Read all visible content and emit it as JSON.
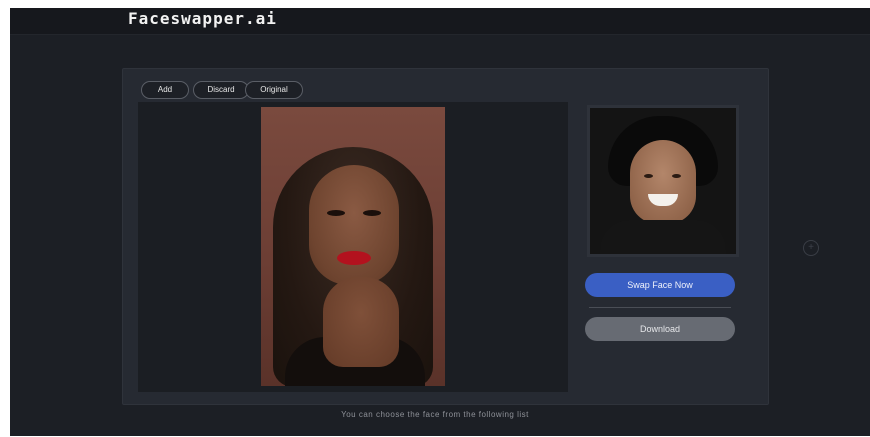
{
  "app": {
    "logo": "Faceswapper.ai"
  },
  "toolbar": {
    "add_label": "Add",
    "discard_label": "Discard",
    "original_label": "Original"
  },
  "actions": {
    "swap_label": "Swap Face Now",
    "download_label": "Download"
  },
  "footer": {
    "text": "You can choose the face from the following list"
  },
  "icons": {
    "side_action": "plus-circle-icon"
  },
  "colors": {
    "background": "#1c1f25",
    "panel": "#262a32",
    "primary": "#3a5fc4",
    "secondary": "#676b73"
  }
}
